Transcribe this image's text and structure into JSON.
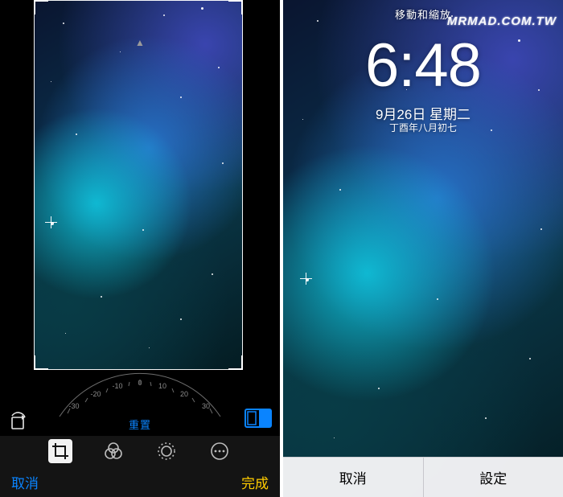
{
  "watermark": "MRMAD.COM.TW",
  "left": {
    "dial_labels": [
      "-30",
      "-20",
      "-10",
      "0",
      "10",
      "20",
      "30"
    ],
    "reset_label": "重置",
    "cancel_label": "取消",
    "done_label": "完成",
    "tool_icons": [
      "crop-icon",
      "filters-icon",
      "light-icon",
      "more-icon"
    ],
    "rotate_icon": "rotate-icon",
    "aspect_icon": "aspect-icon",
    "dial_pointer_glyph": "▲",
    "selected_tool_index": 0
  },
  "right": {
    "move_zoom_label": "移動和縮放",
    "clock": "6:48",
    "date": "9月26日 星期二",
    "lunar": "丁酉年八月初七",
    "cancel_label": "取消",
    "set_label": "設定"
  }
}
